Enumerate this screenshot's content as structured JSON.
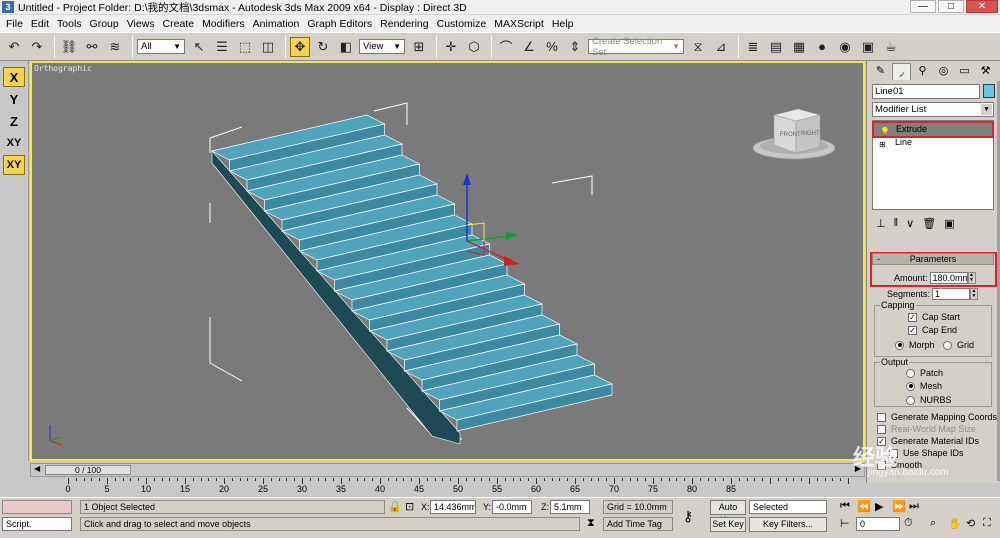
{
  "window": {
    "title": "Untitled     - Project Folder: D:\\我的文档\\3dsmax     - Autodesk 3ds Max  2009 x64     - Display : Direct 3D",
    "minimize": "—",
    "maximize": "□",
    "close": "✕"
  },
  "menu": [
    "File",
    "Edit",
    "Tools",
    "Group",
    "Views",
    "Create",
    "Modifiers",
    "Animation",
    "Graph Editors",
    "Rendering",
    "Customize",
    "MAXScript",
    "Help"
  ],
  "toolbar": {
    "selection_filter": "All",
    "ref_coord": "View",
    "named_selection_placeholder": "Create Selection Set"
  },
  "axis_constraints": [
    "X",
    "Y",
    "Z",
    "XY",
    "XY"
  ],
  "viewport": {
    "label": "Orthographic",
    "viewcube_front": "FRONT",
    "viewcube_right": "RIGHT"
  },
  "command_panel": {
    "object_name": "Line01",
    "object_color": "#5ec8e6",
    "modifier_list": "Modifier List",
    "stack": [
      "Extrude",
      "Line"
    ],
    "parameters_title": "Parameters",
    "amount_label": "Amount:",
    "amount_value": "180.0mm",
    "segments_label": "Segments:",
    "segments_value": "1",
    "capping_label": "Capping",
    "cap_start": "Cap Start",
    "cap_end": "Cap End",
    "morph": "Morph",
    "grid": "Grid",
    "output_label": "Output",
    "patch": "Patch",
    "mesh": "Mesh",
    "nurbs": "NURBS",
    "gen_mapping": "Generate Mapping Coords.",
    "real_world": "Real-World Map Size",
    "gen_material": "Generate Material IDs",
    "use_shape": "Use Shape IDs",
    "smooth": "Smooth"
  },
  "timeline": {
    "frame": "0 / 100",
    "ticks": [
      "0",
      "5",
      "10",
      "15",
      "20",
      "25",
      "30",
      "35",
      "40",
      "45",
      "50",
      "55",
      "60",
      "65",
      "70",
      "75",
      "80",
      "85"
    ]
  },
  "status": {
    "script": "Script.",
    "selected": "1 Object Selected",
    "prompt": "Click and drag to select and move objects",
    "x_label": "X:",
    "x_value": "14.436mm",
    "y_label": "Y:",
    "y_value": "-0.0mm",
    "z_label": "Z:",
    "z_value": "5.1mm",
    "grid": "Grid = 10.0mm",
    "add_time_tag": "Add Time Tag",
    "auto_key": "Auto Key",
    "set_key": "Set Key",
    "selected_dropdown": "Selected",
    "key_filters": "Key Filters...",
    "frame_value": "0"
  },
  "watermark": {
    "brand": "经验",
    "url": "jingyan.baidu.com"
  }
}
